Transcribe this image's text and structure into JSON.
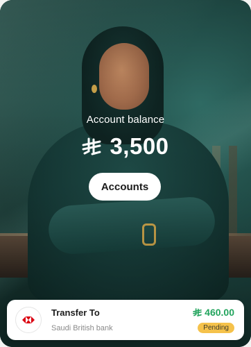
{
  "balance": {
    "label": "Account balance",
    "amount": "3,500",
    "currency_icon": "saudi-riyal-icon"
  },
  "actions": {
    "accounts_label": "Accounts"
  },
  "transaction": {
    "title": "Transfer To",
    "bank": "Saudi British bank",
    "bank_logo": "hsbc-logo",
    "amount": "460.00",
    "status": "Pending"
  },
  "colors": {
    "background": "#183833",
    "amount_green": "#22a45d",
    "pending_badge": "#f5c24b",
    "bank_red": "#db0011"
  }
}
